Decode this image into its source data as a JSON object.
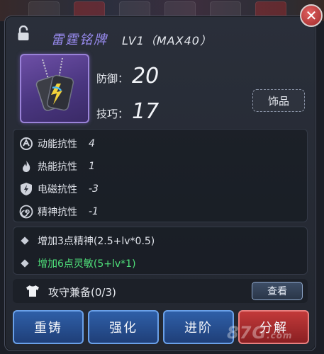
{
  "item": {
    "name": "雷霆铭牌",
    "level": "LV1（MAX40）",
    "type": "饰品"
  },
  "stats": [
    {
      "label": "防御：",
      "value": "20"
    },
    {
      "label": "技巧：",
      "value": "17"
    }
  ],
  "resistances": [
    {
      "label": "动能抗性",
      "value": "4",
      "icon": "kinetic-icon"
    },
    {
      "label": "热能抗性",
      "value": "1",
      "icon": "flame-icon"
    },
    {
      "label": "电磁抗性",
      "value": "-3",
      "icon": "lightning-shield-icon"
    },
    {
      "label": "精神抗性",
      "value": "-1",
      "icon": "spiral-icon"
    }
  ],
  "bonuses": [
    {
      "text": "增加3点精神(2.5+lv*0.5)",
      "active": false
    },
    {
      "text": "增加6点灵敏(5+lv*1)",
      "active": true
    }
  ],
  "set": {
    "label": "攻守兼备(0/3)",
    "view_label": "查看"
  },
  "actions": [
    {
      "label": "重铸"
    },
    {
      "label": "强化"
    },
    {
      "label": "进阶"
    },
    {
      "label": "分解"
    }
  ],
  "close_glyph": "✕",
  "watermark": {
    "main": "87G",
    "suffix": ".com"
  },
  "colors": {
    "item_name": "#9a8cf2",
    "bonus_active": "#4fe07a",
    "action_blue": "#2f5fa8",
    "action_red": "#c23a3a"
  }
}
